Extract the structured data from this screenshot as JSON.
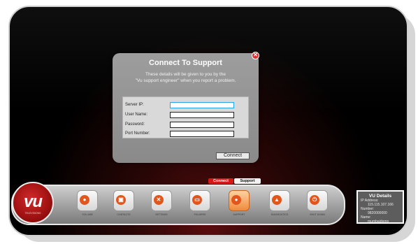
{
  "dialog": {
    "title": "Connect To Support",
    "subtitle_line1": "These details will be given to you by the",
    "subtitle_line2": "\"Vu support engineer\" when you report a problem.",
    "fields": [
      {
        "label": "Server IP:",
        "value": ""
      },
      {
        "label": "User Name:",
        "value": ""
      },
      {
        "label": "Password:",
        "value": ""
      },
      {
        "label": "Port Number:",
        "value": ""
      }
    ],
    "connect_label": "Connect",
    "close_glyph": "✕"
  },
  "tabs": {
    "connect": "Connect",
    "support": "Support"
  },
  "logo": {
    "text": "vu",
    "sub": "TELEVISIONS"
  },
  "dock": {
    "buttons": [
      {
        "caption": "YOU ARE",
        "icon": "user-icon",
        "glyph": "●"
      },
      {
        "caption": "CONTACTS",
        "icon": "contacts-icon",
        "glyph": "▣"
      },
      {
        "caption": "SETTINGS",
        "icon": "settings-icon",
        "glyph": "✕"
      },
      {
        "caption": "FOLDERS",
        "icon": "folder-icon",
        "glyph": "▭"
      },
      {
        "caption": "SUPPORT",
        "icon": "support-icon",
        "glyph": "●"
      },
      {
        "caption": "DIAGNOSTICS",
        "icon": "diagnostics-icon",
        "glyph": "▲"
      },
      {
        "caption": "SHUT DOWN",
        "icon": "power-icon",
        "glyph": "⏻"
      }
    ]
  },
  "details": {
    "title": "VU Details",
    "ip_label": "IP Address:",
    "ip_value": "115.115.107.166",
    "number_label": "Number:",
    "number_value": "9820000000",
    "name_label": "Name:",
    "name_value": "mumbaidemo"
  },
  "colors": {
    "accent_red": "#d21a1a",
    "focus_blue": "#2aa3e6",
    "active_orange": "#f08a3c"
  }
}
